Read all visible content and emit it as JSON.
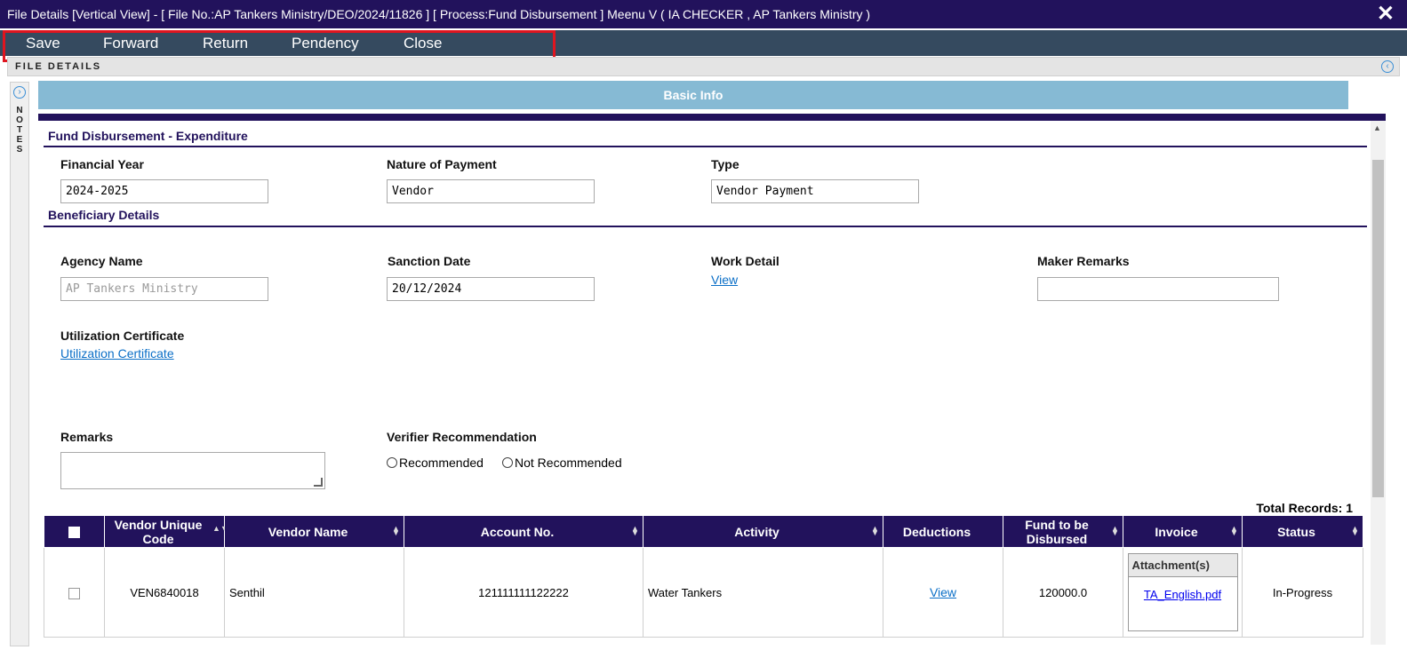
{
  "window": {
    "title": "File Details [Vertical View] - [ File No.:AP Tankers Ministry/DEO/2024/11826 ] [ Process:Fund Disbursement ] Meenu V ( IA CHECKER , AP Tankers Ministry )",
    "close_glyph": "✕"
  },
  "toolbar": {
    "save": "Save",
    "forward": "Forward",
    "return": "Return",
    "pendency": "Pendency",
    "close": "Close"
  },
  "panel": {
    "header": "FILE DETAILS",
    "notes": "N\nO\nT\nE\nS"
  },
  "tab": {
    "label": "Basic Info"
  },
  "section1": {
    "title": "Fund Disbursement - Expenditure",
    "financial_year_label": "Financial Year",
    "financial_year_value": "2024-2025",
    "nature_label": "Nature of Payment",
    "nature_value": "Vendor",
    "type_label": "Type",
    "type_value": "Vendor Payment"
  },
  "section2": {
    "title": "Beneficiary Details",
    "agency_label": "Agency Name",
    "agency_placeholder": "AP Tankers Ministry",
    "sanction_label": "Sanction Date",
    "sanction_value": "20/12/2024",
    "work_label": "Work Detail",
    "work_link": "View",
    "maker_label": "Maker Remarks",
    "maker_value": "",
    "uc_label": "Utilization Certificate",
    "uc_link": "Utilization Certificate",
    "remarks_label": "Remarks",
    "verifier_label": "Verifier Recommendation",
    "opt_recommended": "Recommended",
    "opt_not_recommended": "Not Recommended"
  },
  "table": {
    "total": "Total Records: 1",
    "columns": {
      "vendor_code": "Vendor Unique Code",
      "vendor_name": "Vendor Name",
      "account": "Account No.",
      "activity": "Activity",
      "deductions": "Deductions",
      "fund": "Fund to be Disbursed",
      "invoice": "Invoice",
      "status": "Status"
    },
    "row": {
      "vendor_code": "VEN6840018",
      "vendor_name": "Senthil",
      "account": "121111111122222",
      "activity": "Water Tankers",
      "deductions": "View",
      "fund": "120000.0",
      "attachments_header": "Attachment(s)",
      "attachment_file": "TA_English.pdf",
      "status": "In-Progress"
    }
  },
  "icons": {
    "sort": "▲▼",
    "collapse": "‹",
    "expand": "›",
    "scroll_up": "▲"
  }
}
